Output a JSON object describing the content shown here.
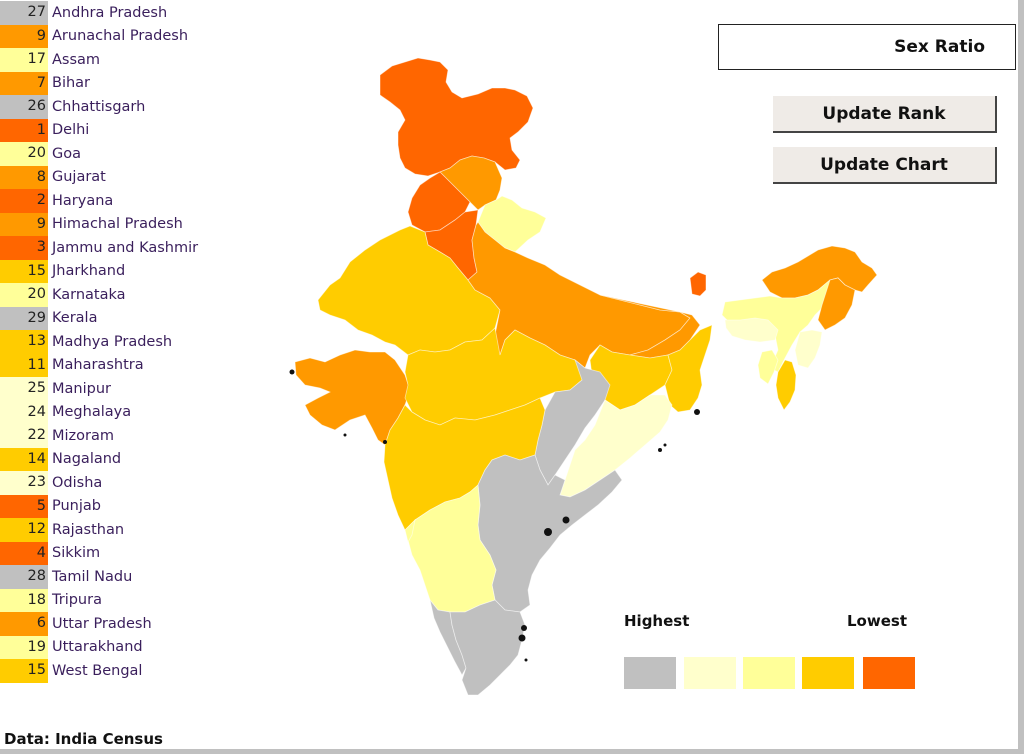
{
  "chart_data": {
    "type": "choropleth-map",
    "title": "Sex Ratio",
    "source": "Data: India Census",
    "legend": {
      "high_label": "Highest",
      "low_label": "Lowest",
      "colors": [
        "#c0c0c0",
        "#ffffcc",
        "#ffff99",
        "#ffcc00",
        "#ff6600"
      ]
    },
    "ranks": [
      {
        "state": "Andhra Pradesh",
        "rank": 27,
        "color": "#c0c0c0"
      },
      {
        "state": "Arunachal Pradesh",
        "rank": 9,
        "color": "#ff9900"
      },
      {
        "state": "Assam",
        "rank": 17,
        "color": "#ffff99"
      },
      {
        "state": "Bihar",
        "rank": 7,
        "color": "#ff9900"
      },
      {
        "state": "Chhattisgarh",
        "rank": 26,
        "color": "#c0c0c0"
      },
      {
        "state": "Delhi",
        "rank": 1,
        "color": "#ff6600"
      },
      {
        "state": "Goa",
        "rank": 20,
        "color": "#ffff99"
      },
      {
        "state": "Gujarat",
        "rank": 8,
        "color": "#ff9900"
      },
      {
        "state": "Haryana",
        "rank": 2,
        "color": "#ff6600"
      },
      {
        "state": "Himachal Pradesh",
        "rank": 9,
        "color": "#ff9900"
      },
      {
        "state": "Jammu and Kashmir",
        "rank": 3,
        "color": "#ff6600"
      },
      {
        "state": "Jharkhand",
        "rank": 15,
        "color": "#ffcc00"
      },
      {
        "state": "Karnataka",
        "rank": 20,
        "color": "#ffff99"
      },
      {
        "state": "Kerala",
        "rank": 29,
        "color": "#c0c0c0"
      },
      {
        "state": "Madhya Pradesh",
        "rank": 13,
        "color": "#ffcc00"
      },
      {
        "state": "Maharashtra",
        "rank": 11,
        "color": "#ffcc00"
      },
      {
        "state": "Manipur",
        "rank": 25,
        "color": "#ffffcc"
      },
      {
        "state": "Meghalaya",
        "rank": 24,
        "color": "#ffffcc"
      },
      {
        "state": "Mizoram",
        "rank": 22,
        "color": "#ffffcc"
      },
      {
        "state": "Nagaland",
        "rank": 14,
        "color": "#ffcc00"
      },
      {
        "state": "Odisha",
        "rank": 23,
        "color": "#ffffcc"
      },
      {
        "state": "Punjab",
        "rank": 5,
        "color": "#ff6600"
      },
      {
        "state": "Rajasthan",
        "rank": 12,
        "color": "#ffcc00"
      },
      {
        "state": "Sikkim",
        "rank": 4,
        "color": "#ff6600"
      },
      {
        "state": "Tamil Nadu",
        "rank": 28,
        "color": "#c0c0c0"
      },
      {
        "state": "Tripura",
        "rank": 18,
        "color": "#ffff99"
      },
      {
        "state": "Uttar Pradesh",
        "rank": 6,
        "color": "#ff9900"
      },
      {
        "state": "Uttarakhand",
        "rank": 19,
        "color": "#ffff99"
      },
      {
        "state": "West Bengal",
        "rank": 15,
        "color": "#ffcc00"
      }
    ],
    "map_regions": [
      {
        "state": "Jammu and Kashmir",
        "color": "#ff6600"
      },
      {
        "state": "Himachal Pradesh",
        "color": "#ff9900"
      },
      {
        "state": "Punjab",
        "color": "#ff6600"
      },
      {
        "state": "Haryana",
        "color": "#ff6600"
      },
      {
        "state": "Uttarakhand",
        "color": "#ffff99"
      },
      {
        "state": "Rajasthan",
        "color": "#ffcc00"
      },
      {
        "state": "Uttar Pradesh",
        "color": "#ff9900"
      },
      {
        "state": "Bihar",
        "color": "#ff9900"
      },
      {
        "state": "Gujarat",
        "color": "#ff9900"
      },
      {
        "state": "Madhya Pradesh",
        "color": "#ffcc00"
      },
      {
        "state": "Jharkhand",
        "color": "#ffcc00"
      },
      {
        "state": "West Bengal",
        "color": "#ffcc00"
      },
      {
        "state": "Sikkim",
        "color": "#ff6600"
      },
      {
        "state": "Chhattisgarh",
        "color": "#c0c0c0"
      },
      {
        "state": "Odisha",
        "color": "#ffffcc"
      },
      {
        "state": "Maharashtra",
        "color": "#ffcc00"
      },
      {
        "state": "Andhra Pradesh",
        "color": "#c0c0c0"
      },
      {
        "state": "Karnataka",
        "color": "#ffff99"
      },
      {
        "state": "Goa",
        "color": "#ffff99"
      },
      {
        "state": "Kerala",
        "color": "#c0c0c0"
      },
      {
        "state": "Tamil Nadu",
        "color": "#c0c0c0"
      },
      {
        "state": "Arunachal Pradesh",
        "color": "#ff9900"
      },
      {
        "state": "Assam",
        "color": "#ffff99"
      },
      {
        "state": "Meghalaya",
        "color": "#ffffcc"
      },
      {
        "state": "Nagaland",
        "color": "#ff9900"
      },
      {
        "state": "Manipur",
        "color": "#ffffcc"
      },
      {
        "state": "Mizoram",
        "color": "#ffcc00"
      },
      {
        "state": "Tripura",
        "color": "#ffff99"
      }
    ]
  },
  "controls": {
    "metric_label": "Sex Ratio",
    "update_rank_label": "Update Rank",
    "update_chart_label": "Update Chart"
  }
}
